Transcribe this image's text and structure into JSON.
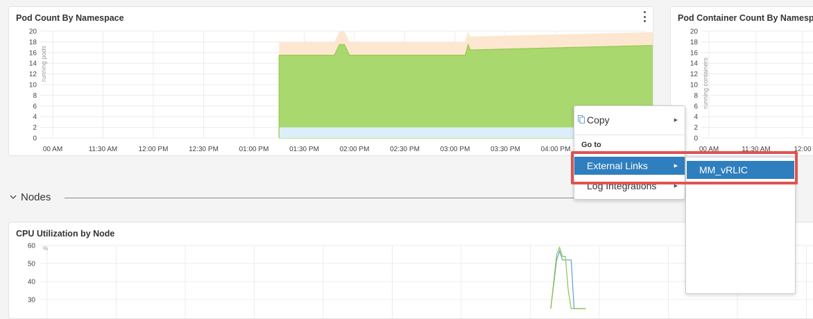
{
  "panels": {
    "pod_count": {
      "title": "Pod Count By Namespace"
    },
    "pod_container": {
      "title": "Pod Container Count By Namespa"
    },
    "cpu": {
      "title": "CPU Utilization by Node"
    }
  },
  "section": {
    "label": "Nodes"
  },
  "context_menu": {
    "copy_label": "Copy",
    "goto_header": "Go to",
    "external_links_label": "External Links",
    "log_integrations_label": "Log Integrations"
  },
  "submenu": {
    "item_label": "MM_vRLIC"
  },
  "colors": {
    "accent": "#2f7fbf",
    "highlight": "#e05252",
    "series_green": "#a9d86e",
    "series_orange": "#fde7d1",
    "series_blue": "#dceefa"
  },
  "chart_data": [
    {
      "type": "area",
      "title": "Pod Count By Namespace",
      "ylabel": "running pods",
      "ylim": [
        0,
        20
      ],
      "y_ticks": [
        "0",
        "2",
        "4",
        "6",
        "8",
        "10",
        "12",
        "14",
        "16",
        "18",
        "20"
      ],
      "x_ticks": [
        "00 AM",
        "11:30 AM",
        "12:00 PM",
        "12:30 PM",
        "01:00 PM",
        "01:30 PM",
        "02:00 PM",
        "02:30 PM",
        "03:00 PM",
        "03:30 PM",
        "04:00 PM"
      ],
      "x": [
        12.75,
        13.3,
        13.35,
        13.4,
        13.45,
        14.6,
        14.63,
        14.65,
        16.8
      ],
      "series": [
        {
          "color": "#dceefa",
          "values": [
            2,
            2,
            2,
            2,
            2,
            2,
            2,
            2,
            2
          ]
        },
        {
          "color": "#a9d86e",
          "values": [
            15.5,
            15.5,
            17.5,
            17.5,
            15.5,
            15.5,
            17.5,
            16.5,
            17.5
          ]
        },
        {
          "color": "#fde7d1",
          "values": [
            18,
            18,
            20,
            20,
            18,
            18,
            20,
            19,
            20
          ]
        }
      ],
      "grid": true
    },
    {
      "type": "area",
      "title": "Pod Container Count By Namespa",
      "ylabel": "running containers",
      "ylim": [
        0,
        20
      ],
      "y_ticks": [
        "0",
        "2",
        "4",
        "6",
        "8",
        "10",
        "12",
        "14",
        "16",
        "18",
        "20"
      ],
      "x_ticks": [
        "00 AM",
        "11:30 AM",
        "12:00"
      ],
      "series": [],
      "grid": true
    },
    {
      "type": "line",
      "title": "CPU Utilization by Node",
      "ylabel": "%",
      "ylim": [
        25,
        60
      ],
      "y_ticks": [
        "30",
        "40",
        "50",
        "60"
      ],
      "x": [
        0.0,
        0.2,
        0.3,
        0.4,
        0.5,
        0.6,
        0.7,
        0.8,
        1.2
      ],
      "series": [
        {
          "color": "#5aa0d8",
          "values": [
            25,
            52,
            57,
            52,
            52,
            52,
            52,
            25,
            25
          ]
        },
        {
          "color": "#8cc63f",
          "values": [
            25,
            55,
            59,
            54,
            54,
            35,
            25,
            25,
            25
          ]
        }
      ],
      "grid": true
    }
  ]
}
